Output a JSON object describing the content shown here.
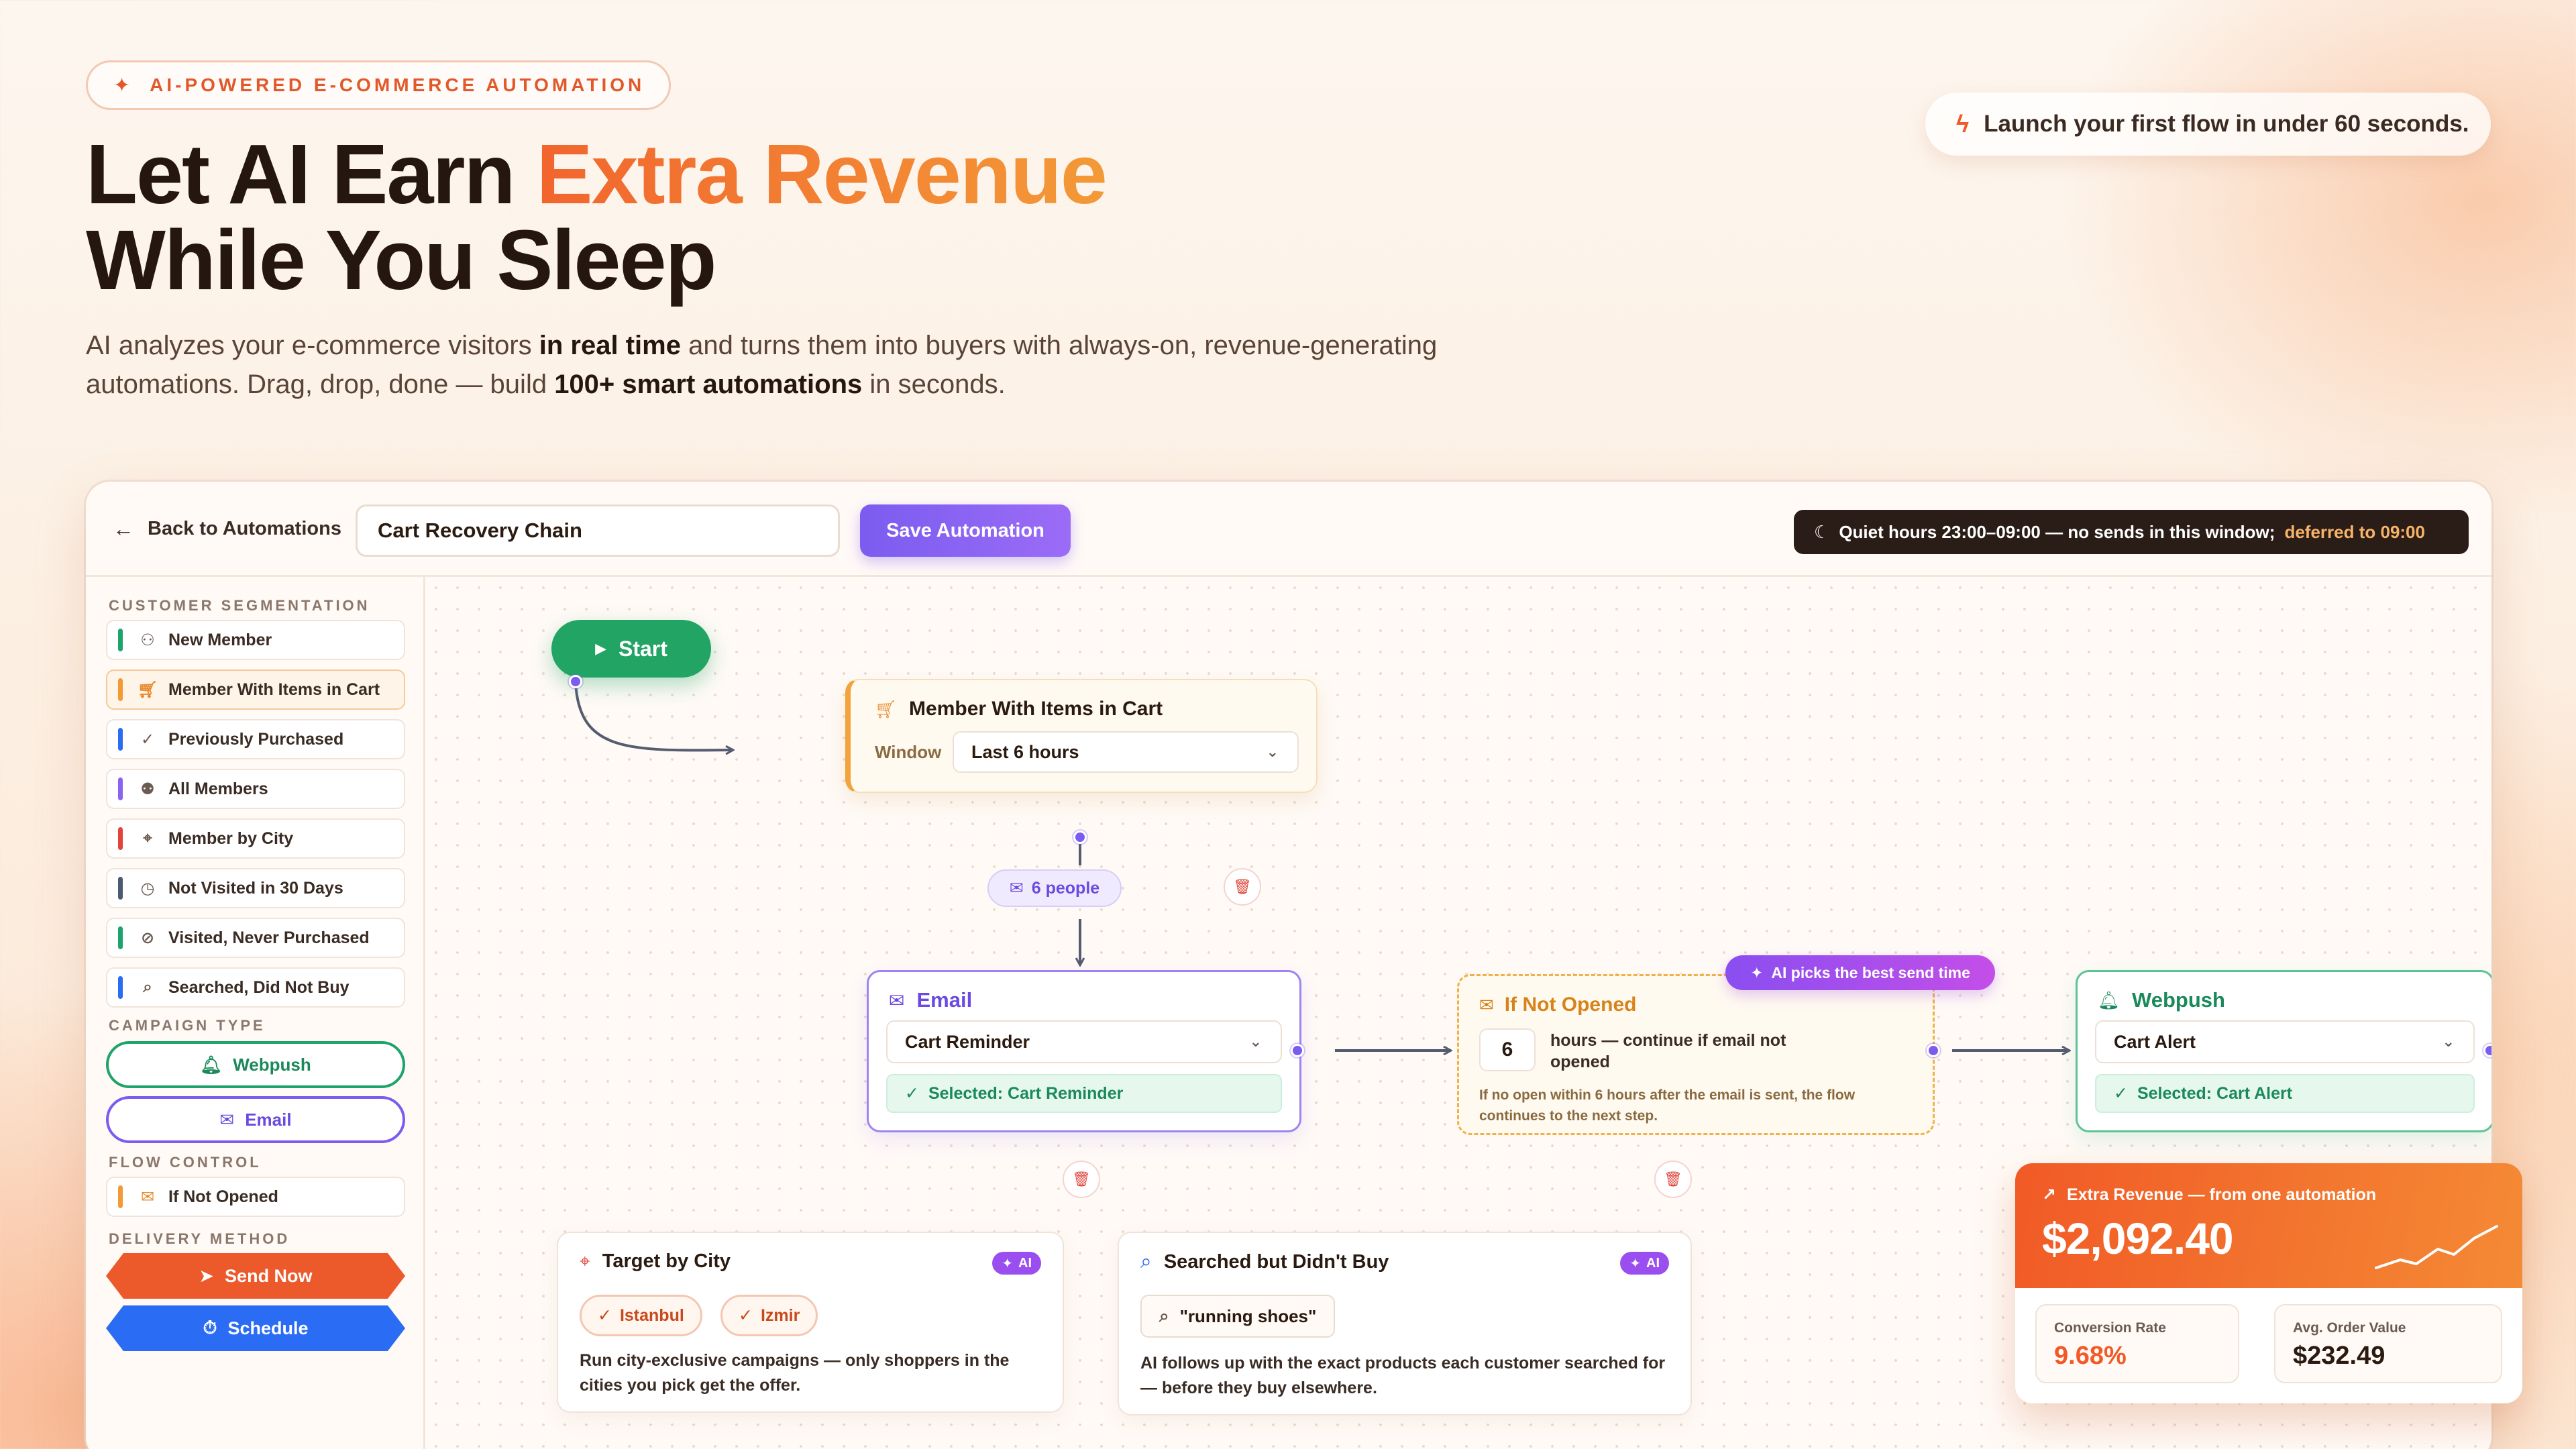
{
  "hero": {
    "eyebrow": "AI-POWERED E-COMMERCE AUTOMATION",
    "title_part1": "Let AI Earn ",
    "title_highlight": "Extra Revenue",
    "title_line2": "While You Sleep",
    "sub_1": "AI analyzes your e-commerce visitors ",
    "sub_b1": "in real time",
    "sub_2": " and turns them into buyers with always-on, revenue-generating automations. Drag, drop, done — build ",
    "sub_b2": "100+ smart automations",
    "sub_3": " in seconds.",
    "launch": "Launch your first flow in under 60 seconds."
  },
  "topbar": {
    "back": "Back to Automations",
    "automation_name": "Cart Recovery Chain",
    "save": "Save Automation",
    "quiet": "Quiet hours 23:00–09:00 — no sends in this window;",
    "deferred": "deferred to 09:00"
  },
  "sidebar": {
    "segmentation_label": "CUSTOMER SEGMENTATION",
    "segments": [
      {
        "label": "New Member",
        "color": "#1fa36c",
        "icon": "user-plus-icon"
      },
      {
        "label": "Member With Items in Cart",
        "color": "#f39a37",
        "icon": "cart-icon"
      },
      {
        "label": "Previously Purchased",
        "color": "#2a6cf4",
        "icon": "check-circle-icon"
      },
      {
        "label": "All Members",
        "color": "#8a63f0",
        "icon": "users-icon"
      },
      {
        "label": "Member by City",
        "color": "#e0443a",
        "icon": "location-pin-icon"
      },
      {
        "label": "Not Visited in 30 Days",
        "color": "#4a5a70",
        "icon": "clock-icon"
      },
      {
        "label": "Visited, Never Purchased",
        "color": "#1fa36c",
        "icon": "eye-off-icon"
      },
      {
        "label": "Searched, Did Not Buy",
        "color": "#2a6cf4",
        "icon": "search-icon"
      }
    ],
    "campaign_label": "CAMPAIGN TYPE",
    "campaign_webpush": "Webpush",
    "campaign_email": "Email",
    "flow_label": "FLOW CONTROL",
    "flow_item": "If Not Opened",
    "delivery_label": "DELIVERY METHOD",
    "send_now": "Send Now",
    "schedule": "Schedule"
  },
  "canvas": {
    "start": "Start",
    "segment_node": {
      "title": "Member With Items in Cart",
      "window_label": "Window",
      "window_value": "Last 6 hours"
    },
    "people_badge": "6 people",
    "email_node": {
      "title": "Email",
      "template": "Cart Reminder",
      "selected": "Selected: Cart Reminder"
    },
    "ai_badge": "AI picks the best send time",
    "if_node": {
      "title": "If Not Opened",
      "hours": "6",
      "hours_text": "hours — continue if email not opened",
      "desc": "If no open within 6 hours after the email is sent, the flow continues to the next step."
    },
    "webpush_node": {
      "title": "Webpush",
      "template": "Cart Alert",
      "selected": "Selected: Cart Alert"
    },
    "city_card": {
      "title": "Target by City",
      "ai": "AI",
      "chips": [
        "Istanbul",
        "Izmir"
      ],
      "desc": "Run city-exclusive campaigns — only shoppers in the cities you pick get the offer."
    },
    "search_card": {
      "title": "Searched but Didn't Buy",
      "ai": "AI",
      "query": "\"running shoes\"",
      "desc": "AI follows up with the exact products each customer searched for — before they buy elsewhere."
    }
  },
  "revenue": {
    "label": "Extra Revenue — from one automation",
    "amount": "$2,092.40",
    "conv_label": "Conversion Rate",
    "conv_value": "9.68%",
    "aov_label": "Avg. Order Value",
    "aov_value": "$232.49"
  },
  "colors": {
    "accent_orange": "#f15a26",
    "accent_purple": "#7b5cf0",
    "accent_green": "#1fa36c",
    "accent_blue": "#2a6cf4"
  }
}
